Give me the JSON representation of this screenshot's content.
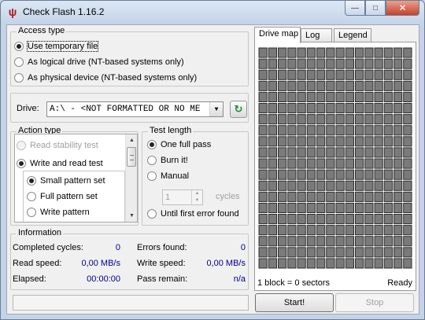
{
  "window": {
    "title": "Check Flash 1.16.2",
    "icon": "usb-icon",
    "minimize": "—",
    "maximize": "□",
    "close": "✕"
  },
  "access_type": {
    "legend": "Access type",
    "options": [
      {
        "label": "Use temporary file",
        "selected": true
      },
      {
        "label": "As logical drive (NT-based systems only)",
        "selected": false
      },
      {
        "label": "As physical device (NT-based systems only)",
        "selected": false
      }
    ]
  },
  "drive": {
    "label": "Drive:",
    "value": "A:\\ - <NOT FORMATTED OR NO ME",
    "refresh_icon": "refresh-icon"
  },
  "action_type": {
    "legend": "Action type",
    "options": [
      {
        "label": "Read stability test",
        "selected": false,
        "disabled": true
      },
      {
        "label": "Write and read test",
        "selected": true,
        "disabled": false
      }
    ],
    "pattern_options": [
      {
        "label": "Small pattern set",
        "selected": true
      },
      {
        "label": "Full pattern set",
        "selected": false
      },
      {
        "label": "Write pattern",
        "selected": false
      }
    ]
  },
  "test_length": {
    "legend": "Test length",
    "options": [
      {
        "label": "One full pass",
        "selected": true
      },
      {
        "label": "Burn it!",
        "selected": false
      },
      {
        "label": "Manual",
        "selected": false
      },
      {
        "label": "Until first error found",
        "selected": false
      }
    ],
    "cycles_value": "1",
    "cycles_label": "cycles"
  },
  "information": {
    "legend": "Information",
    "completed_cycles_label": "Completed cycles:",
    "completed_cycles": "0",
    "errors_found_label": "Errors found:",
    "errors_found": "0",
    "read_speed_label": "Read speed:",
    "read_speed": "0,00 MB/s",
    "write_speed_label": "Write speed:",
    "write_speed": "0,00 MB/s",
    "elapsed_label": "Elapsed:",
    "elapsed": "00:00:00",
    "pass_remain_label": "Pass remain:",
    "pass_remain": "n/a"
  },
  "tabs": [
    "Drive map",
    "Log",
    "Legend"
  ],
  "drive_map": {
    "block_info": "1 block = 0 sectors",
    "status": "Ready",
    "columns": 16,
    "rows": 20,
    "cell_color": "#7a7a7a"
  },
  "buttons": {
    "start": "Start!",
    "stop": "Stop"
  }
}
